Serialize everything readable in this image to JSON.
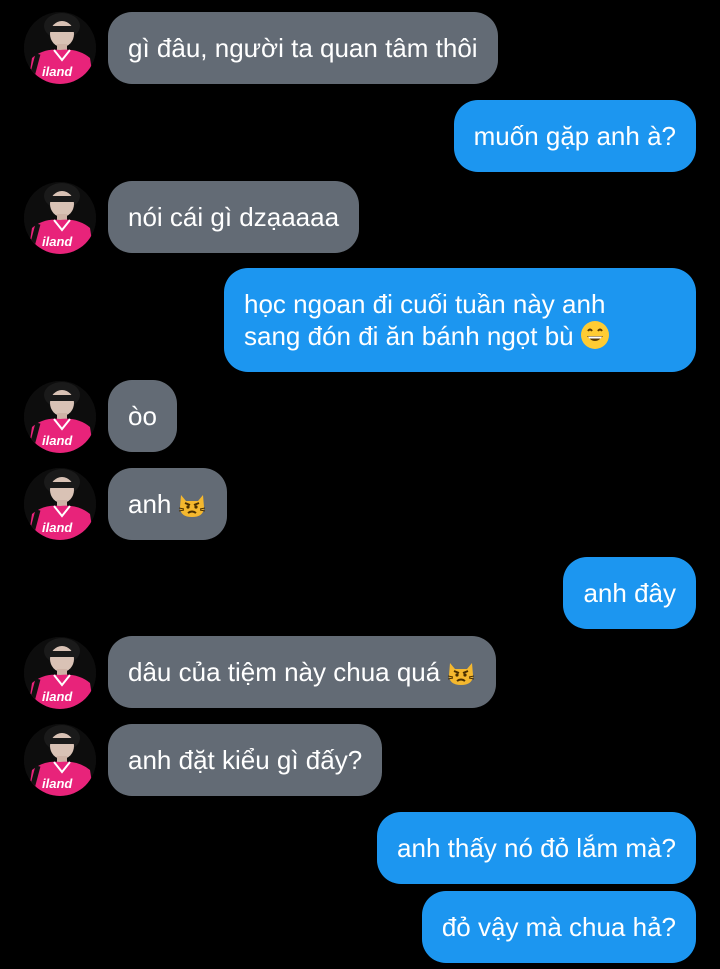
{
  "colors": {
    "background": "#000000",
    "incoming_bubble": "#636b75",
    "outgoing_bubble": "#1c96f0",
    "text": "#ffffff",
    "avatar_shirt": "#e8237a"
  },
  "avatar": {
    "shirt_text": "iland"
  },
  "messages": [
    {
      "side": "in",
      "text": "gì đâu, người ta quan tâm thôi"
    },
    {
      "side": "out",
      "text": "muốn gặp anh à?"
    },
    {
      "side": "in",
      "text": "nói cái gì dzạaaaa"
    },
    {
      "side": "out",
      "line1": "học ngoan đi cuối tuần này anh",
      "line2": "sang đón đi ăn bánh ngọt bù",
      "emoji": "grinning-face-emoji"
    },
    {
      "side": "in",
      "text": "òo"
    },
    {
      "side": "in",
      "text": "anh",
      "emoji": "pouting-cat-emoji"
    },
    {
      "side": "out",
      "text": "anh đây"
    },
    {
      "side": "in",
      "text": "dâu của tiệm này chua quá",
      "emoji": "pouting-cat-emoji"
    },
    {
      "side": "in",
      "text": "anh đặt kiểu gì đấy?"
    },
    {
      "side": "out",
      "text": "anh thấy nó đỏ lắm mà?"
    },
    {
      "side": "out",
      "text": "đỏ vậy mà chua hả?"
    }
  ]
}
